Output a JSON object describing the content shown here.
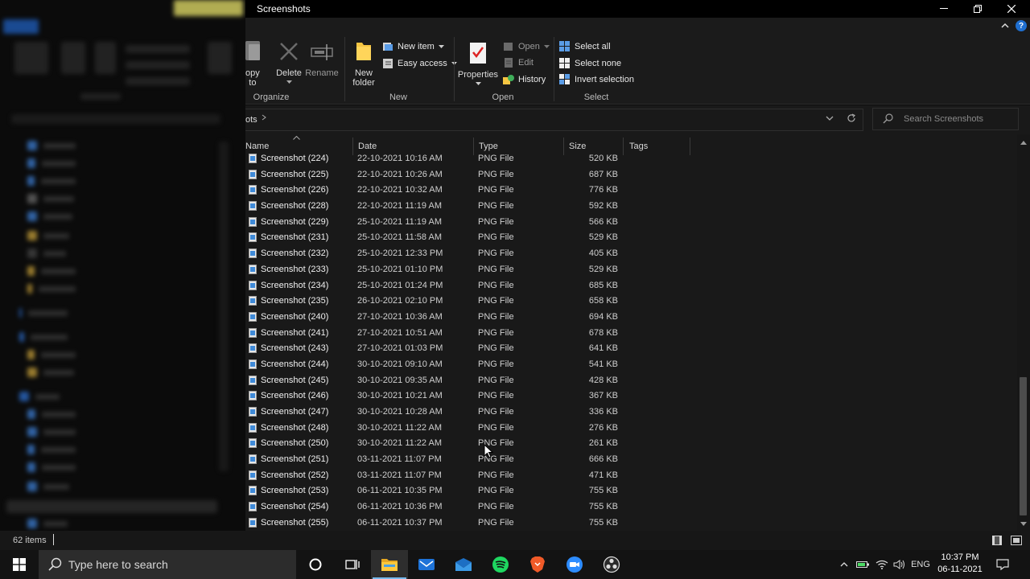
{
  "window": {
    "title": "Screenshots",
    "controls": {
      "minimize": "—",
      "maximize": "❐",
      "close": "✕"
    }
  },
  "ribbon": {
    "groups": {
      "organize": {
        "label": "Organize",
        "copy_to_partial": "opy\nto",
        "delete": "Delete",
        "rename": "Rename"
      },
      "new": {
        "label": "New",
        "new_folder": "New\nfolder",
        "new_item": "New item",
        "easy_access": "Easy access"
      },
      "open": {
        "label": "Open",
        "properties": "Properties",
        "open": "Open",
        "edit": "Edit",
        "history": "History"
      },
      "select": {
        "label": "Select",
        "select_all": "Select all",
        "select_none": "Select none",
        "invert_selection": "Invert selection"
      }
    }
  },
  "address": {
    "crumb": "ots",
    "search_placeholder": "Search Screenshots"
  },
  "columns": {
    "name": "Name",
    "date": "Date",
    "type": "Type",
    "size": "Size",
    "tags": "Tags"
  },
  "files": [
    {
      "name": "Screenshot (224)",
      "date": "22-10-2021 10:16 AM",
      "type": "PNG File",
      "size": "520 KB"
    },
    {
      "name": "Screenshot (225)",
      "date": "22-10-2021 10:26 AM",
      "type": "PNG File",
      "size": "687 KB"
    },
    {
      "name": "Screenshot (226)",
      "date": "22-10-2021 10:32 AM",
      "type": "PNG File",
      "size": "776 KB"
    },
    {
      "name": "Screenshot (228)",
      "date": "22-10-2021 11:19 AM",
      "type": "PNG File",
      "size": "592 KB"
    },
    {
      "name": "Screenshot (229)",
      "date": "25-10-2021 11:19 AM",
      "type": "PNG File",
      "size": "566 KB"
    },
    {
      "name": "Screenshot (231)",
      "date": "25-10-2021 11:58 AM",
      "type": "PNG File",
      "size": "529 KB"
    },
    {
      "name": "Screenshot (232)",
      "date": "25-10-2021 12:33 PM",
      "type": "PNG File",
      "size": "405 KB"
    },
    {
      "name": "Screenshot (233)",
      "date": "25-10-2021 01:10 PM",
      "type": "PNG File",
      "size": "529 KB"
    },
    {
      "name": "Screenshot (234)",
      "date": "25-10-2021 01:24 PM",
      "type": "PNG File",
      "size": "685 KB"
    },
    {
      "name": "Screenshot (235)",
      "date": "26-10-2021 02:10 PM",
      "type": "PNG File",
      "size": "658 KB"
    },
    {
      "name": "Screenshot (240)",
      "date": "27-10-2021 10:36 AM",
      "type": "PNG File",
      "size": "694 KB"
    },
    {
      "name": "Screenshot (241)",
      "date": "27-10-2021 10:51 AM",
      "type": "PNG File",
      "size": "678 KB"
    },
    {
      "name": "Screenshot (243)",
      "date": "27-10-2021 01:03 PM",
      "type": "PNG File",
      "size": "641 KB"
    },
    {
      "name": "Screenshot (244)",
      "date": "30-10-2021 09:10 AM",
      "type": "PNG File",
      "size": "541 KB"
    },
    {
      "name": "Screenshot (245)",
      "date": "30-10-2021 09:35 AM",
      "type": "PNG File",
      "size": "428 KB"
    },
    {
      "name": "Screenshot (246)",
      "date": "30-10-2021 10:21 AM",
      "type": "PNG File",
      "size": "367 KB"
    },
    {
      "name": "Screenshot (247)",
      "date": "30-10-2021 10:28 AM",
      "type": "PNG File",
      "size": "336 KB"
    },
    {
      "name": "Screenshot (248)",
      "date": "30-10-2021 11:22 AM",
      "type": "PNG File",
      "size": "276 KB"
    },
    {
      "name": "Screenshot (250)",
      "date": "30-10-2021 11:22 AM",
      "type": "PNG File",
      "size": "261 KB"
    },
    {
      "name": "Screenshot (251)",
      "date": "03-11-2021 11:07 PM",
      "type": "PNG File",
      "size": "666 KB"
    },
    {
      "name": "Screenshot (252)",
      "date": "03-11-2021 11:07 PM",
      "type": "PNG File",
      "size": "471 KB"
    },
    {
      "name": "Screenshot (253)",
      "date": "06-11-2021 10:35 PM",
      "type": "PNG File",
      "size": "755 KB"
    },
    {
      "name": "Screenshot (254)",
      "date": "06-11-2021 10:36 PM",
      "type": "PNG File",
      "size": "755 KB"
    },
    {
      "name": "Screenshot (255)",
      "date": "06-11-2021 10:37 PM",
      "type": "PNG File",
      "size": "755 KB"
    }
  ],
  "status": {
    "item_count": "62 items"
  },
  "taskbar": {
    "search_placeholder": "Type here to search",
    "apps": [
      "cortana-circle-icon",
      "task-view-icon",
      "file-explorer-icon",
      "mail-app-icon",
      "outlook-icon",
      "spotify-icon",
      "brave-icon",
      "zoom-icon",
      "obs-icon"
    ],
    "language": "ENG",
    "time": "10:37 PM",
    "date": "06-11-2021"
  },
  "colors": {
    "accent": "#1f6fd0",
    "folder": "#f5c542",
    "background": "#191919"
  }
}
